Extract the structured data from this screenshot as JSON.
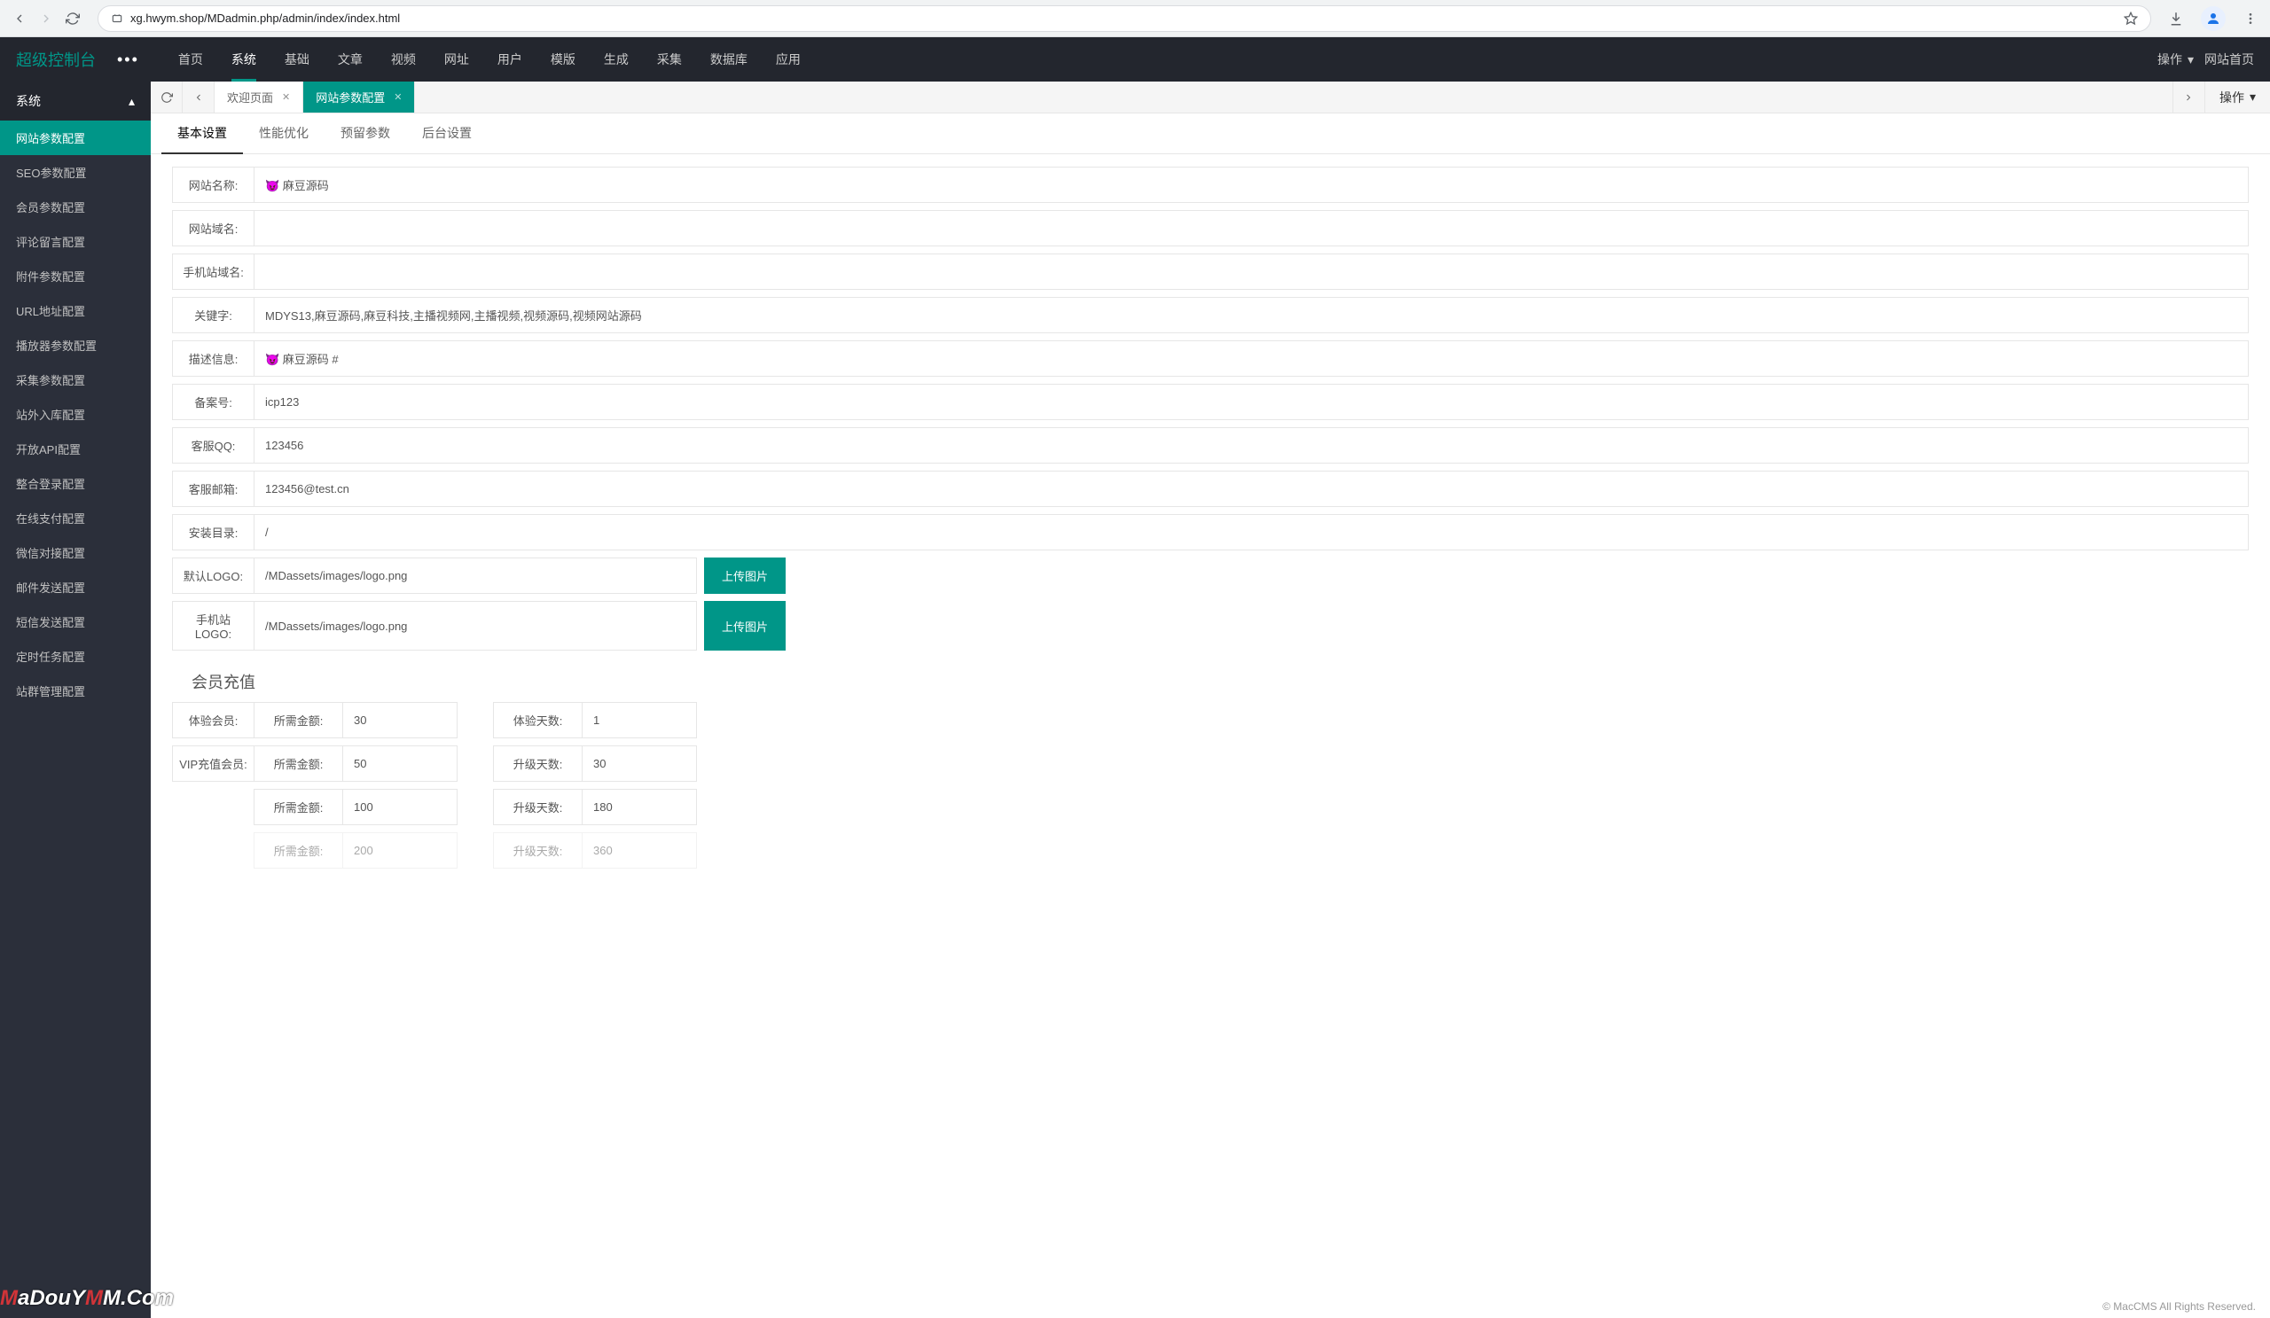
{
  "browser": {
    "url": "xg.hwym.shop/MDadmin.php/admin/index/index.html"
  },
  "brand": "超级控制台",
  "topnav": {
    "items": [
      "首页",
      "系统",
      "基础",
      "文章",
      "视频",
      "网址",
      "用户",
      "模版",
      "生成",
      "采集",
      "数据库",
      "应用"
    ],
    "action_label": "操作",
    "home_label": "网站首页"
  },
  "sidebar": {
    "header": "系统",
    "items": [
      "网站参数配置",
      "SEO参数配置",
      "会员参数配置",
      "评论留言配置",
      "附件参数配置",
      "URL地址配置",
      "播放器参数配置",
      "采集参数配置",
      "站外入库配置",
      "开放API配置",
      "整合登录配置",
      "在线支付配置",
      "微信对接配置",
      "邮件发送配置",
      "短信发送配置",
      "定时任务配置",
      "站群管理配置"
    ]
  },
  "tabs": {
    "t0": "欢迎页面",
    "t1": "网站参数配置",
    "op": "操作"
  },
  "subtabs": [
    "基本设置",
    "性能优化",
    "预留参数",
    "后台设置"
  ],
  "form": {
    "site_name_label": "网站名称:",
    "site_name": "😈 麻豆源码",
    "site_domain_label": "网站域名:",
    "site_domain": "",
    "mobile_domain_label": "手机站域名:",
    "mobile_domain": "",
    "keywords_label": "关键字:",
    "keywords": "MDYS13,麻豆源码,麻豆科技,主播视频网,主播视频,视频源码,视频网站源码",
    "description_label": "描述信息:",
    "description": "😈 麻豆源码 #",
    "icp_label": "备案号:",
    "icp": "icp123",
    "qq_label": "客服QQ:",
    "qq": "123456",
    "email_label": "客服邮箱:",
    "email": "123456@test.cn",
    "install_dir_label": "安装目录:",
    "install_dir": "/",
    "logo_label": "默认LOGO:",
    "logo": "/MDassets/images/logo.png",
    "mobile_logo_label": "手机站LOGO:",
    "mobile_logo": "/MDassets/images/logo.png",
    "upload_btn": "上传图片"
  },
  "recharge": {
    "title": "会员充值",
    "trial_label": "体验会员:",
    "vip_label": "VIP充值会员:",
    "amount_label": "所需金额:",
    "trial_days_label": "体验天数:",
    "upgrade_days_label": "升级天数:",
    "r0": {
      "amount": "30",
      "days": "1"
    },
    "r1": {
      "amount": "50",
      "days": "30"
    },
    "r2": {
      "amount": "100",
      "days": "180"
    },
    "r3": {
      "amount": "200",
      "days": "360"
    }
  },
  "footer": "© MacCMS All Rights Reserved.",
  "watermark": {
    "a": "M",
    "b": "aDouY",
    "c": "M.Com"
  }
}
